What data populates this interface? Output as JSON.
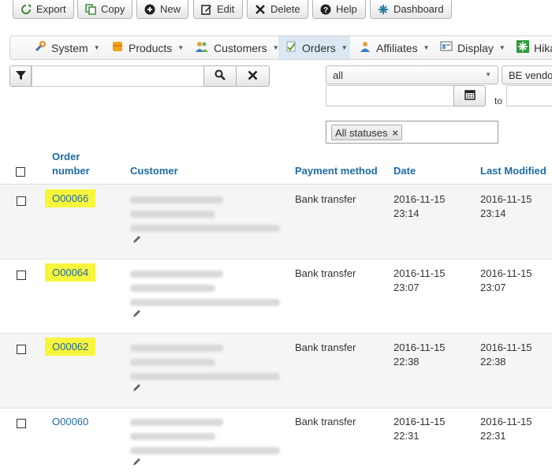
{
  "toolbar": {
    "export": "Export",
    "copy": "Copy",
    "new": "New",
    "edit": "Edit",
    "delete": "Delete",
    "help": "Help",
    "dashboard": "Dashboard"
  },
  "menu": {
    "system": "System",
    "products": "Products",
    "customers": "Customers",
    "orders": "Orders",
    "affiliates": "Affiliates",
    "display": "Display",
    "hika": "Hika"
  },
  "filters": {
    "search_value": "",
    "type_select": "all",
    "vendor_select": "BE vendo",
    "date_from": "",
    "to_label": "to",
    "date_to": "",
    "status_tag": "All statuses",
    "status_remove": "×"
  },
  "table": {
    "headers": {
      "order_number": "Order number",
      "customer": "Customer",
      "payment": "Payment method",
      "date": "Date",
      "modified": "Last Modified"
    },
    "rows": [
      {
        "order": "O00066",
        "payment": "Bank transfer",
        "date": "2016-11-15",
        "time": "23:14",
        "mod_date": "2016-11-15",
        "mod_time": "23:14"
      },
      {
        "order": "O00064",
        "payment": "Bank transfer",
        "date": "2016-11-15",
        "time": "23:07",
        "mod_date": "2016-11-15",
        "mod_time": "23:07"
      },
      {
        "order": "O00062",
        "payment": "Bank transfer",
        "date": "2016-11-15",
        "time": "22:38",
        "mod_date": "2016-11-15",
        "mod_time": "22:38"
      },
      {
        "order": "O00060",
        "payment": "Bank transfer",
        "date": "2016-11-15",
        "time": "22:31",
        "mod_date": "2016-11-15",
        "mod_time": "22:31"
      }
    ]
  },
  "colors": {
    "link": "#1e6ba8",
    "highlight": "#f7f53b",
    "row_alt": "#f5f5f5",
    "menu_active": "#dbe7f2"
  }
}
